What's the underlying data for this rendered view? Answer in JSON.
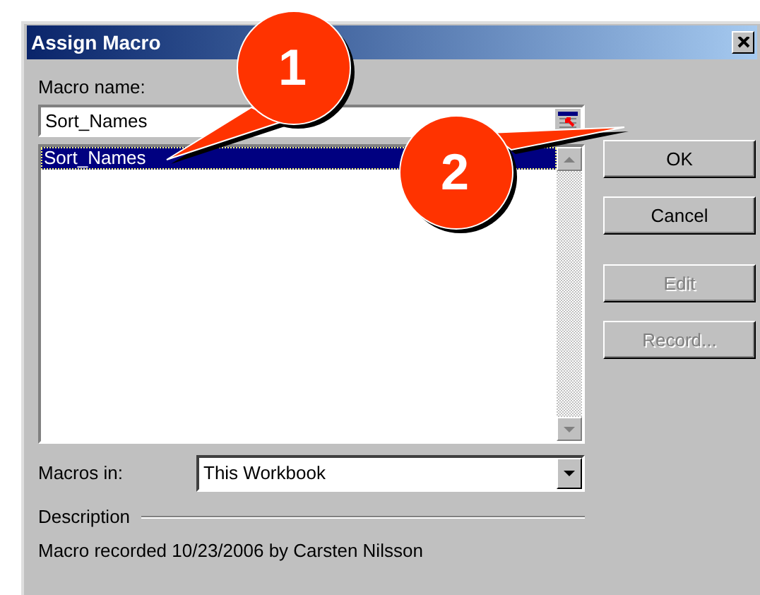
{
  "window": {
    "title": "Assign Macro"
  },
  "macro_name": {
    "label": "Macro name:",
    "value": "Sort_Names"
  },
  "macros": [
    {
      "name": "Sort_Names",
      "selected": true
    }
  ],
  "buttons": [
    {
      "label": "OK",
      "disabled": false
    },
    {
      "label": "Cancel",
      "disabled": false
    },
    {
      "label": "Edit",
      "disabled": true
    },
    {
      "label": "Record...",
      "disabled": true
    }
  ],
  "macros_in": {
    "label": "Macros in:",
    "value": "This Workbook"
  },
  "description": {
    "label": "Description",
    "text": "Macro recorded 10/23/2006 by Carsten Nilsson"
  },
  "callouts": [
    {
      "number": "1"
    },
    {
      "number": "2"
    }
  ]
}
